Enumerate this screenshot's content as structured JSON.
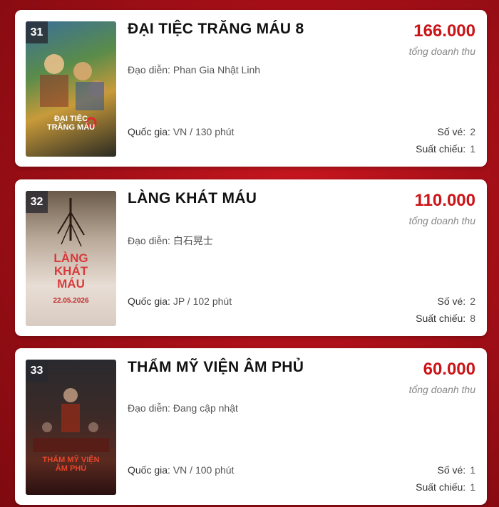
{
  "movies": [
    {
      "rank": "31",
      "title": "ĐẠI TIỆC TRĂNG MÁU 8",
      "director_label": "Đạo diễn:",
      "director": "Phan Gia Nhật Linh",
      "country_label": "Quốc gia:",
      "country": "VN / 130 phút",
      "revenue": "166.000",
      "revenue_label": "tổng doanh thu",
      "tickets_label": "Số vé:",
      "tickets": "2",
      "showings_label": "Suất chiếu:",
      "showings": "1",
      "poster_text_1": "ĐẠI TIỆC",
      "poster_text_2": "TRĂNG MÁU"
    },
    {
      "rank": "32",
      "title": "LÀNG KHÁT MÁU",
      "director_label": "Đạo diễn:",
      "director": "白石晃士",
      "country_label": "Quốc gia:",
      "country": "JP / 102 phút",
      "revenue": "110.000",
      "revenue_label": "tổng doanh thu",
      "tickets_label": "Số vé:",
      "tickets": "2",
      "showings_label": "Suất chiếu:",
      "showings": "8",
      "poster_text_1": "LÀNG",
      "poster_text_2": "KHÁT",
      "poster_text_3": "MÁU",
      "poster_date": "22.05.2026"
    },
    {
      "rank": "33",
      "title": "THẨM MỸ VIỆN ÂM PHỦ",
      "director_label": "Đạo diễn:",
      "director": "Đang cập nhật",
      "country_label": "Quốc gia:",
      "country": "VN / 100 phút",
      "revenue": "60.000",
      "revenue_label": "tổng doanh thu",
      "tickets_label": "Số vé:",
      "tickets": "1",
      "showings_label": "Suất chiếu:",
      "showings": "1",
      "poster_text_1": "THẨM MỸ VIỆN",
      "poster_text_2": "ÂM PHỦ"
    }
  ]
}
